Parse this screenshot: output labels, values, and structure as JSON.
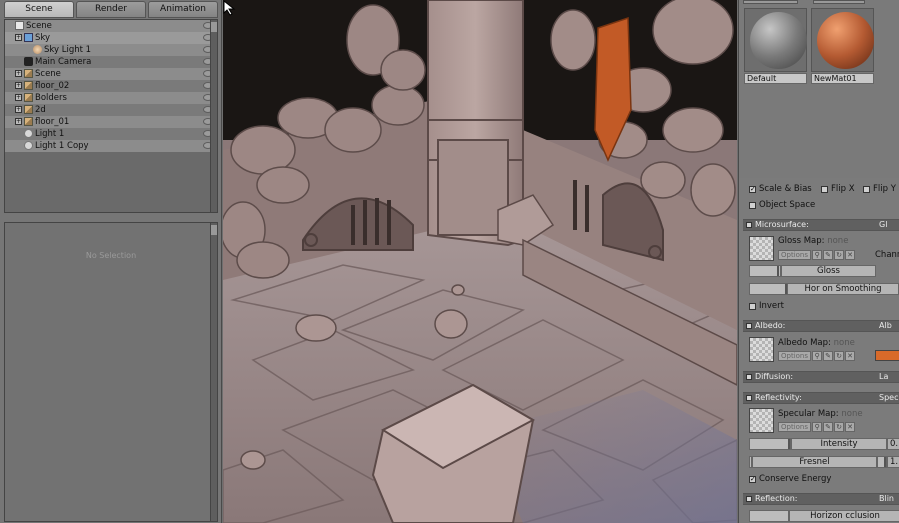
{
  "tabs": [
    "Scene",
    "Render",
    "Animation"
  ],
  "outliner": {
    "items": [
      {
        "label": "Scene",
        "icon": "file-icon"
      },
      {
        "label": "Sky",
        "icon": "sky-icon"
      },
      {
        "label": "Sky Light 1",
        "icon": "light-icon"
      },
      {
        "label": "Main Camera",
        "icon": "camera-icon"
      },
      {
        "label": "Scene",
        "icon": "mesh-icon"
      },
      {
        "label": "floor_02",
        "icon": "mesh-icon"
      },
      {
        "label": "Bolders",
        "icon": "mesh-icon"
      },
      {
        "label": "2d",
        "icon": "mesh-icon"
      },
      {
        "label": "floor_01",
        "icon": "mesh-icon"
      },
      {
        "label": "Light 1",
        "icon": "bulb-icon"
      },
      {
        "label": "Light 1 Copy",
        "icon": "bulb-icon"
      }
    ]
  },
  "properties": {
    "empty_text": "No Selection"
  },
  "materials": [
    {
      "name": "Default",
      "color": "#7a7a7a"
    },
    {
      "name": "NewMat01",
      "color": "#b45a32"
    }
  ],
  "surface": {
    "scale_bias": "Scale & Bias",
    "flip_x": "Flip X",
    "flip_y": "Flip Y",
    "object_space": "Object Space"
  },
  "microsurface": {
    "header": "Microsurface:",
    "header_right": "Gl",
    "map_label": "Gloss Map:",
    "map_value": "none",
    "options": "Options",
    "channel": "Chann",
    "gloss": "Gloss",
    "horizon_smoothing": "Hor  on Smoothing",
    "invert": "Invert"
  },
  "albedo": {
    "header": "Albedo:",
    "header_right": "Alb",
    "map_label": "Albedo Map:",
    "map_value": "none",
    "options": "Options",
    "color": "#d86a2a"
  },
  "diffusion": {
    "header": "Diffusion:",
    "header_right": "La"
  },
  "reflectivity": {
    "header": "Reflectivity:",
    "header_right": "Spec",
    "map_label": "Specular Map:",
    "map_value": "none",
    "options": "Options",
    "intensity": "Intensity",
    "intensity_value": "0.",
    "fresnel": "Fresnel",
    "fresnel_value": "1.",
    "conserve_energy": "Conserve Energy"
  },
  "reflection": {
    "header": "Reflection:",
    "header_right": "Blin",
    "horizon_occlusion": "Horizon  cclusion"
  },
  "icons": {
    "check": "✓",
    "expand": "+",
    "search": "⚲",
    "edit": "✎",
    "refresh": "↻",
    "clear": "✕"
  }
}
